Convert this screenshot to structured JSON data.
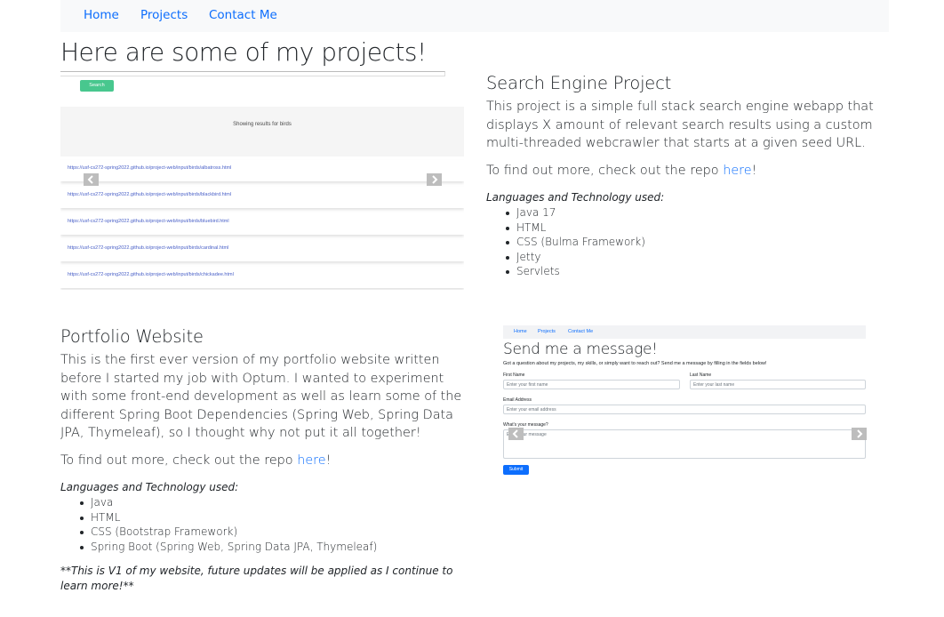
{
  "nav": {
    "items": [
      "Home",
      "Projects",
      "Contact Me"
    ]
  },
  "page_title": "Here are some of my projects!",
  "project1": {
    "title": "Search Engine Project",
    "description": "This project is a simple full stack search engine webapp that displays X amount of relevant search results using a custom multi-threaded webcrawler that starts at a given seed URL.",
    "repo_prefix": "To find out more, check out the repo ",
    "repo_link": "here",
    "repo_suffix": "!",
    "lang_title": "Languages and Technology used:",
    "tech": [
      "Java 17",
      "HTML",
      "CSS (Bulma Framework)",
      "Jetty",
      "Servlets"
    ],
    "screenshot": {
      "search_button": "Search",
      "results_heading": "Showing results for birds",
      "results": [
        "https://usf-cs272-spring2022.github.io/project-web/input/birds/albatross.html",
        "https://usf-cs272-spring2022.github.io/project-web/input/birds/blackbird.html",
        "https://usf-cs272-spring2022.github.io/project-web/input/birds/bluebird.html",
        "https://usf-cs272-spring2022.github.io/project-web/input/birds/cardinal.html",
        "https://usf-cs272-spring2022.github.io/project-web/input/birds/chickadee.html"
      ]
    }
  },
  "project2": {
    "title": "Portfolio Website",
    "description": "This is the first ever version of my portfolio website written before I started my job with Optum. I wanted to experiment with some front-end development as well as learn some of the different Spring Boot Dependencies (Spring Web, Spring Data JPA, Thymeleaf), so I thought why not put it all together!",
    "repo_prefix": "To find out more, check out the repo ",
    "repo_link": "here",
    "repo_suffix": "!",
    "lang_title": "Languages and Technology used:",
    "tech": [
      "Java",
      "HTML",
      "CSS (Bootstrap Framework)",
      "Spring Boot (Spring Web, Spring Data JPA, Thymeleaf)"
    ],
    "note": "**This is V1 of my website, future updates will be applied as I continue to learn more!**",
    "screenshot": {
      "nav": [
        "Home",
        "Projects",
        "Contact Me"
      ],
      "title": "Send me a message!",
      "subtitle": "Got a question about my projects, my skills, or simply want to reach out? Send me a message by filling in the fields below!",
      "first_name_label": "First Name",
      "first_name_placeholder": "Enter your first name",
      "last_name_label": "Last Name",
      "last_name_placeholder": "Enter your last name",
      "email_label": "Email Address",
      "email_placeholder": "Enter your email address",
      "message_label": "What's your message?",
      "message_placeholder": "Enter your message",
      "submit": "Submit"
    }
  },
  "colors": {
    "link": "#0d6efd",
    "search_button": "#48c78e",
    "navbar_bg": "#f8f9fa"
  },
  "icons": {
    "prev": "chevron-left-icon",
    "next": "chevron-right-icon"
  }
}
